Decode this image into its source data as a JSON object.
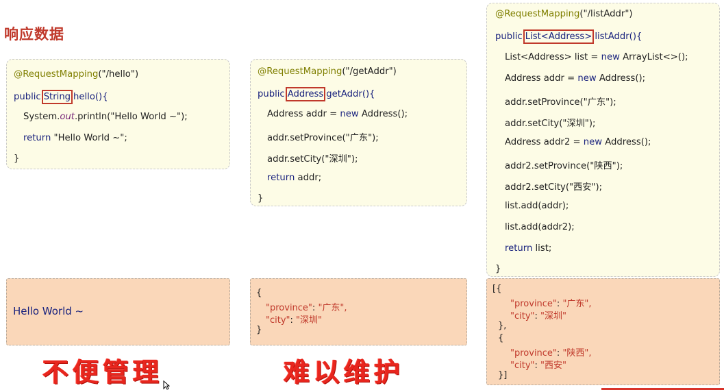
{
  "title": "响应数据",
  "box1": {
    "annotation": "@RequestMapping",
    "path": "(\"/hello\")",
    "public": "public",
    "ret_type": "String",
    "method": "hello(){",
    "l3_a": "System.",
    "l3_b": "out",
    "l3_c": ".println(\"Hello World ~\");",
    "ret": "return",
    "ret_val": "\"Hello World ~\";",
    "close": "}"
  },
  "box2": {
    "annotation": "@RequestMapping",
    "path": "(\"/getAddr\")",
    "public": "public",
    "ret_type": "Address",
    "method": "getAddr(){",
    "l3": "Address addr = ",
    "l3_new": "new",
    "l3_b": " Address();",
    "l4": "addr.setProvince(\"广东\");",
    "l5": "addr.setCity(\"深圳\");",
    "ret": "return",
    "ret_val": " addr;",
    "close": "}"
  },
  "box3": {
    "annotation": "@RequestMapping",
    "path": "(\"/listAddr\")",
    "public": "public",
    "ret_type": "List<Address>",
    "method": "listAddr(){",
    "l3": "List<Address> list = ",
    "l3_new": "new",
    "l3_b": " ArrayList<>();",
    "l4": "Address addr = ",
    "l4_new": "new",
    "l4_b": " Address();",
    "l5": "addr.setProvince(\"广东\");",
    "l6": "addr.setCity(\"深圳\");",
    "l7": "Address addr2 = ",
    "l7_new": "new",
    "l7_b": " Address();",
    "l8": "addr2.setProvince(\"陕西\");",
    "l9": "addr2.setCity(\"西安\");",
    "l10": "list.add(addr);",
    "l11": "list.add(addr2);",
    "ret": "return",
    "ret_val": " list;",
    "close": "}"
  },
  "resp1": {
    "text": "Hello World ~"
  },
  "resp2": {
    "open": "{",
    "k1": "\"province\"",
    "v1": "\"广东\",",
    "k2": "\"city\"",
    "v2": "\"深圳\"",
    "close": "}"
  },
  "resp3": {
    "l1": "[{",
    "k1": "\"province\"",
    "v1": "\"广东\",",
    "k2": "\"city\"",
    "v2": "\"深圳\"",
    "l4": "},",
    "l5": "{",
    "k3": "\"province\"",
    "v3": "\"陕西\",",
    "k4": "\"city\"",
    "v4": "\"西安\"",
    "l8": "}]"
  },
  "note1": "不便管理",
  "note2": "难以维护",
  "colon": ": "
}
